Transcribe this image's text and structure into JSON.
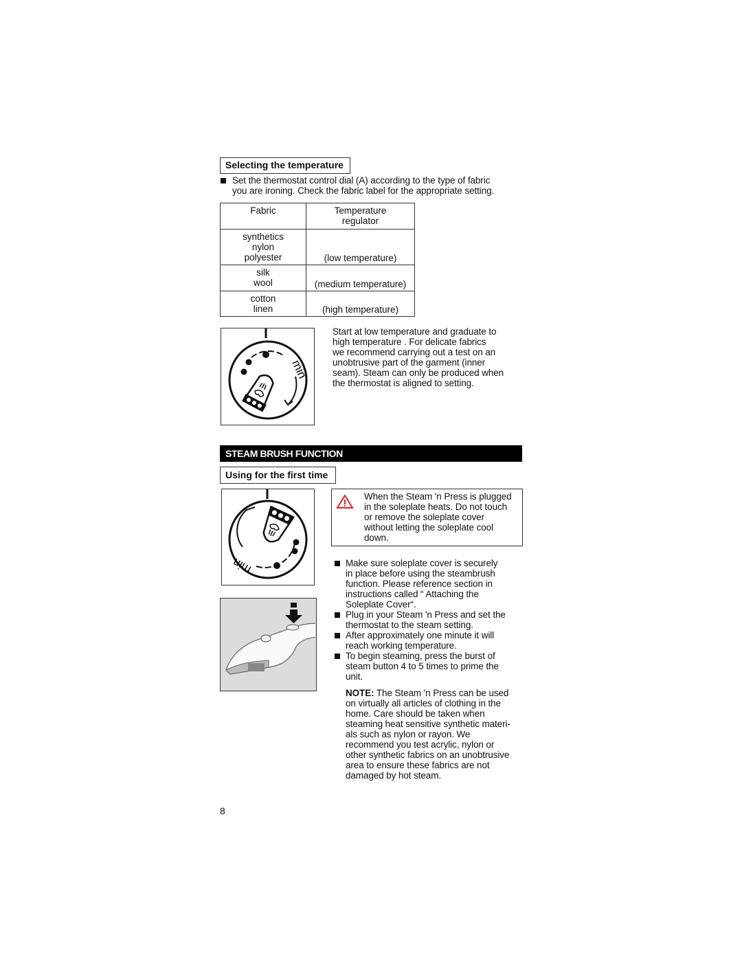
{
  "section1": {
    "heading": "Selecting the temperature",
    "instruction": [
      "Set the thermostat control dial (A) according to the type of fabric",
      "you are ironing. Check the fabric label for the appropriate setting."
    ],
    "table": {
      "headers": [
        [
          "Fabric"
        ],
        [
          "Temperature",
          "regulator"
        ]
      ],
      "rows": [
        {
          "fabric": [
            "synthetics",
            "nylon",
            "polyester"
          ],
          "setting": "(low temperature)"
        },
        {
          "fabric": [
            "silk",
            "wool"
          ],
          "setting": "(medium temperature)"
        },
        {
          "fabric": [
            "cotton",
            "linen"
          ],
          "setting": "(high temperature)"
        }
      ]
    },
    "dial_label": "min",
    "paragraph": [
      "Start at low temperature    and graduate to",
      "high temperature          . For delicate fabrics",
      "we recommend carrying out a test on an",
      "unobtrusive part of the garment (inner",
      "seam). Steam can only be produced when",
      "the thermostat is aligned to           setting."
    ]
  },
  "section2": {
    "banner": "STEAM BRUSH FUNCTION",
    "heading": "Using for the first time",
    "dial_label": "min",
    "warning": [
      "When the Steam 'n Press is plugged",
      "in the soleplate heats. Do not touch",
      "or remove the soleplate cover",
      "without letting the soleplate cool",
      "down."
    ],
    "bullets": [
      [
        "Make sure soleplate cover is securely",
        "in place before using the steambrush",
        "function. Please reference section in",
        "instructions called “ Attaching the",
        "Soleplate Cover“."
      ],
      [
        "Plug in your Steam 'n Press and set the",
        "thermostat to the          steam setting."
      ],
      [
        "After approximately one minute it will",
        "reach working temperature."
      ],
      [
        "To begin steaming, press the burst of",
        "steam button 4 to 5 times to prime the",
        "unit."
      ]
    ],
    "note_label": "NOTE:",
    "note": [
      " The Steam 'n Press can be used",
      "on virtually all articles of clothing in the",
      "home. Care should be taken when",
      "steaming heat sensitive synthetic materi-",
      "als such as nylon or rayon. We",
      "recommend you test acrylic, nylon or",
      "other synthetic fabrics on an unobtrusive",
      "area to ensure these fabrics are not",
      "damaged by hot steam."
    ]
  },
  "page_number": "8",
  "colors": {
    "warning": "#d9232a",
    "banner": "#000000",
    "image_bg": "#dcdcdc"
  }
}
